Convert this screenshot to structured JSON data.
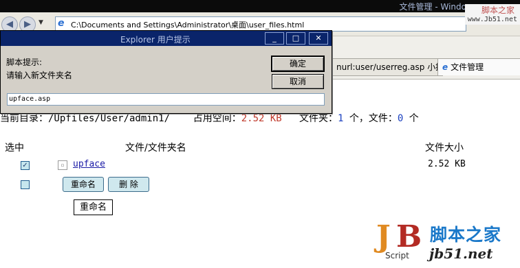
{
  "browser": {
    "window_title": "文件管理 - Windo",
    "address": "C:\\Documents and Settings\\Administrator\\桌面\\user_files.html",
    "tabs": [
      {
        "label": "nurl:user/userreg.asp 小提..."
      },
      {
        "label": "文件管理"
      }
    ]
  },
  "watermark_top": {
    "line1": "脚本之家",
    "line2": "www.Jb51.net"
  },
  "dialog": {
    "title": "Explorer 用户提示",
    "prompt_label": "脚本提示:",
    "prompt_text": "请输入新文件夹名",
    "ok_label": "确定",
    "cancel_label": "取消",
    "input_value": "upface.asp"
  },
  "page": {
    "current_dir_label": "当前目录：",
    "current_dir": "/Upfiles/User/admin1/",
    "space_label": "占用空间：",
    "space_value": "2.52 KB",
    "folders_label": "文件夹：",
    "folders_count": "1",
    "folders_unit": "个，文件：",
    "files_count": "0",
    "files_unit": "个",
    "col_select": "选中",
    "col_name": "文件/文件夹名",
    "col_size": "文件大小",
    "rows": [
      {
        "name": "upface",
        "size": "2.52 KB",
        "checked": "✓"
      }
    ],
    "rename_button": "重命名",
    "delete_button": "删 除",
    "rename_box": "重命名"
  },
  "watermark_bottom": {
    "cn": "脚本之家",
    "url": "jb51.net",
    "script": "Script"
  },
  "colors": {
    "dialog_title": "#0a246a",
    "link": "#1a1aa6",
    "highlight_red": "#c0392b",
    "highlight_blue": "#1a3fbf"
  }
}
